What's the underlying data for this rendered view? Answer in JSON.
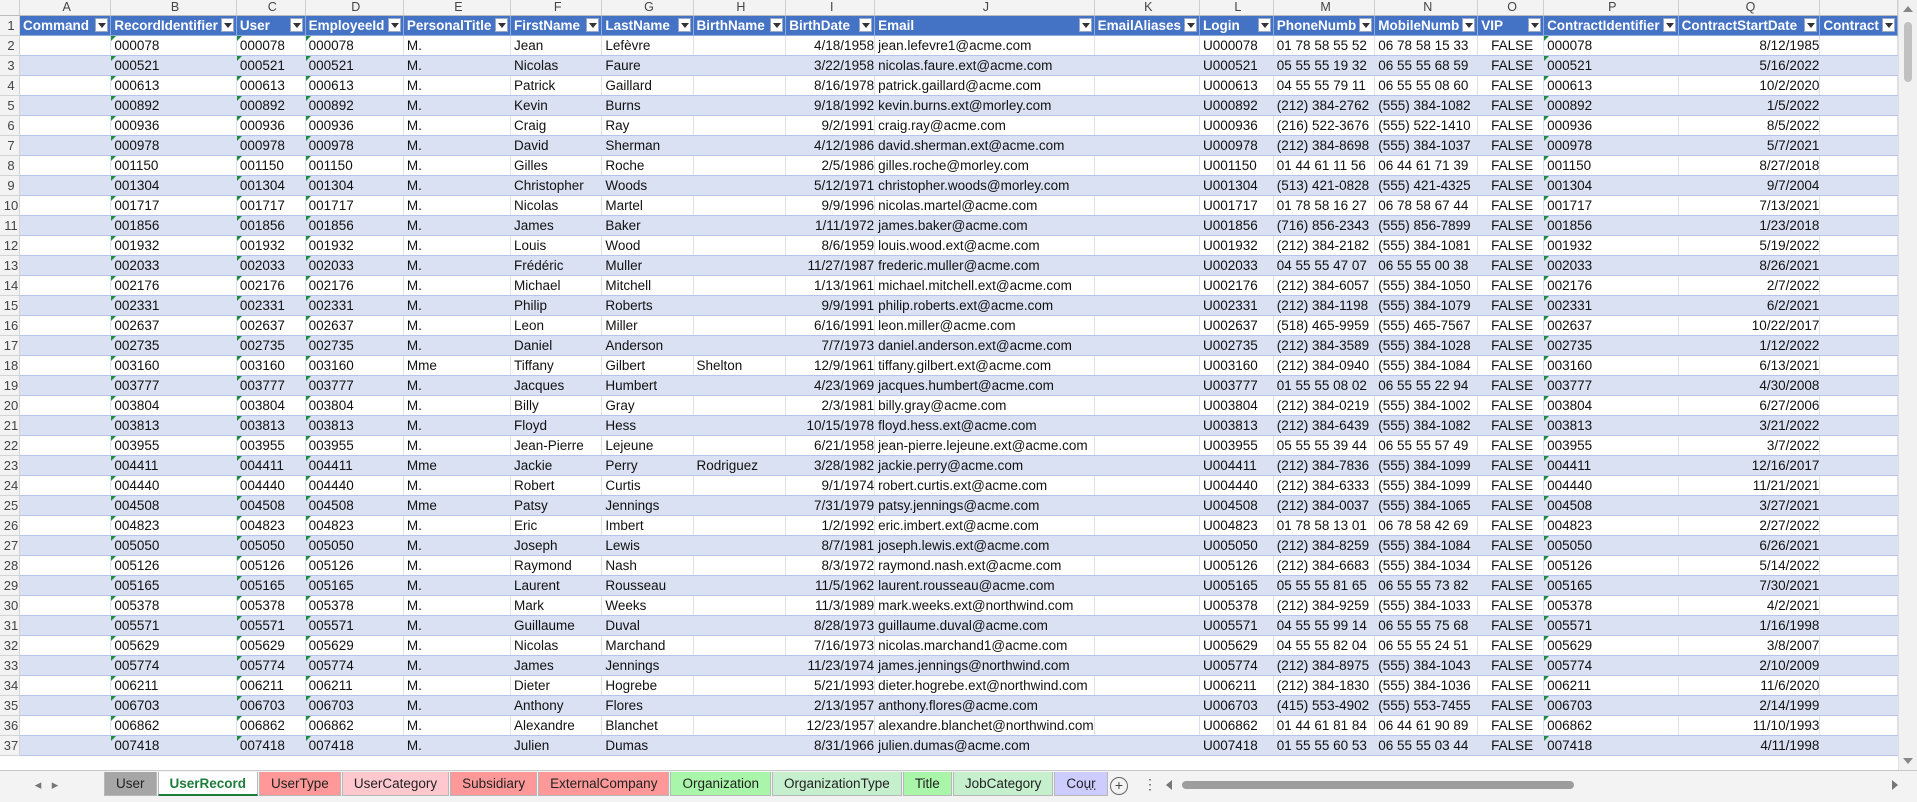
{
  "column_letters": [
    "A",
    "B",
    "C",
    "D",
    "E",
    "F",
    "G",
    "H",
    "I",
    "J",
    "K",
    "L",
    "M",
    "N",
    "O",
    "P",
    "Q"
  ],
  "header_row_number": "1",
  "headers": [
    "Command",
    "RecordIdentifier",
    "User",
    "EmployeeId",
    "PersonalTitle",
    "FirstName",
    "LastName",
    "BirthName",
    "BirthDate",
    "Email",
    "EmailAliases",
    "Login",
    "PhoneNumb",
    "MobileNumb",
    "VIP",
    "ContractIdentifier",
    "ContractStartDate",
    "Contract"
  ],
  "rows": [
    {
      "n": "2",
      "c": [
        "",
        "000078",
        "000078",
        "000078",
        "M.",
        "Jean",
        "Lefèvre",
        "",
        "4/18/1958",
        "jean.lefevre1@acme.com",
        "",
        "U000078",
        "01 78 58 55 52",
        "06 78 58 15 33",
        "FALSE",
        "000078",
        "8/12/1985"
      ]
    },
    {
      "n": "3",
      "c": [
        "",
        "000521",
        "000521",
        "000521",
        "M.",
        "Nicolas",
        "Faure",
        "",
        "3/22/1958",
        "nicolas.faure.ext@acme.com",
        "",
        "U000521",
        "05 55 55 19 32",
        "06 55 55 68 59",
        "FALSE",
        "000521",
        "5/16/2022"
      ]
    },
    {
      "n": "4",
      "c": [
        "",
        "000613",
        "000613",
        "000613",
        "M.",
        "Patrick",
        "Gaillard",
        "",
        "8/16/1978",
        "patrick.gaillard@acme.com",
        "",
        "U000613",
        "04 55 55 79 11",
        "06 55 55 08 60",
        "FALSE",
        "000613",
        "10/2/2020"
      ]
    },
    {
      "n": "5",
      "c": [
        "",
        "000892",
        "000892",
        "000892",
        "M.",
        "Kevin",
        "Burns",
        "",
        "9/18/1992",
        "kevin.burns.ext@morley.com",
        "",
        "U000892",
        "(212) 384-2762",
        "(555) 384-1082",
        "FALSE",
        "000892",
        "1/5/2022"
      ]
    },
    {
      "n": "6",
      "c": [
        "",
        "000936",
        "000936",
        "000936",
        "M.",
        "Craig",
        "Ray",
        "",
        "9/2/1991",
        "craig.ray@acme.com",
        "",
        "U000936",
        "(216) 522-3676",
        "(555) 522-1410",
        "FALSE",
        "000936",
        "8/5/2022"
      ]
    },
    {
      "n": "7",
      "c": [
        "",
        "000978",
        "000978",
        "000978",
        "M.",
        "David",
        "Sherman",
        "",
        "4/12/1986",
        "david.sherman.ext@acme.com",
        "",
        "U000978",
        "(212) 384-8698",
        "(555) 384-1037",
        "FALSE",
        "000978",
        "5/7/2021"
      ]
    },
    {
      "n": "8",
      "c": [
        "",
        "001150",
        "001150",
        "001150",
        "M.",
        "Gilles",
        "Roche",
        "",
        "2/5/1986",
        "gilles.roche@morley.com",
        "",
        "U001150",
        "01 44 61 11 56",
        "06 44 61 71 39",
        "FALSE",
        "001150",
        "8/27/2018"
      ]
    },
    {
      "n": "9",
      "c": [
        "",
        "001304",
        "001304",
        "001304",
        "M.",
        "Christopher",
        "Woods",
        "",
        "5/12/1971",
        "christopher.woods@morley.com",
        "",
        "U001304",
        "(513) 421-0828",
        "(555) 421-4325",
        "FALSE",
        "001304",
        "9/7/2004"
      ]
    },
    {
      "n": "10",
      "c": [
        "",
        "001717",
        "001717",
        "001717",
        "M.",
        "Nicolas",
        "Martel",
        "",
        "9/9/1996",
        "nicolas.martel@acme.com",
        "",
        "U001717",
        "01 78 58 16 27",
        "06 78 58 67 44",
        "FALSE",
        "001717",
        "7/13/2021"
      ]
    },
    {
      "n": "11",
      "c": [
        "",
        "001856",
        "001856",
        "001856",
        "M.",
        "James",
        "Baker",
        "",
        "1/11/1972",
        "james.baker@acme.com",
        "",
        "U001856",
        "(716) 856-2343",
        "(555) 856-7899",
        "FALSE",
        "001856",
        "1/23/2018"
      ]
    },
    {
      "n": "12",
      "c": [
        "",
        "001932",
        "001932",
        "001932",
        "M.",
        "Louis",
        "Wood",
        "",
        "8/6/1959",
        "louis.wood.ext@acme.com",
        "",
        "U001932",
        "(212) 384-2182",
        "(555) 384-1081",
        "FALSE",
        "001932",
        "5/19/2022"
      ]
    },
    {
      "n": "13",
      "c": [
        "",
        "002033",
        "002033",
        "002033",
        "M.",
        "Frédéric",
        "Muller",
        "",
        "11/27/1987",
        "frederic.muller@acme.com",
        "",
        "U002033",
        "04 55 55 47 07",
        "06 55 55 00 38",
        "FALSE",
        "002033",
        "8/26/2021"
      ]
    },
    {
      "n": "14",
      "c": [
        "",
        "002176",
        "002176",
        "002176",
        "M.",
        "Michael",
        "Mitchell",
        "",
        "1/13/1961",
        "michael.mitchell.ext@acme.com",
        "",
        "U002176",
        "(212) 384-6057",
        "(555) 384-1050",
        "FALSE",
        "002176",
        "2/7/2022"
      ]
    },
    {
      "n": "15",
      "c": [
        "",
        "002331",
        "002331",
        "002331",
        "M.",
        "Philip",
        "Roberts",
        "",
        "9/9/1991",
        "philip.roberts.ext@acme.com",
        "",
        "U002331",
        "(212) 384-1198",
        "(555) 384-1079",
        "FALSE",
        "002331",
        "6/2/2021"
      ]
    },
    {
      "n": "16",
      "c": [
        "",
        "002637",
        "002637",
        "002637",
        "M.",
        "Leon",
        "Miller",
        "",
        "6/16/1991",
        "leon.miller@acme.com",
        "",
        "U002637",
        "(518) 465-9959",
        "(555) 465-7567",
        "FALSE",
        "002637",
        "10/22/2017"
      ]
    },
    {
      "n": "17",
      "c": [
        "",
        "002735",
        "002735",
        "002735",
        "M.",
        "Daniel",
        "Anderson",
        "",
        "7/7/1973",
        "daniel.anderson.ext@acme.com",
        "",
        "U002735",
        "(212) 384-3589",
        "(555) 384-1028",
        "FALSE",
        "002735",
        "1/12/2022"
      ]
    },
    {
      "n": "18",
      "c": [
        "",
        "003160",
        "003160",
        "003160",
        "Mme",
        "Tiffany",
        "Gilbert",
        "Shelton",
        "12/9/1961",
        "tiffany.gilbert.ext@acme.com",
        "",
        "U003160",
        "(212) 384-0940",
        "(555) 384-1084",
        "FALSE",
        "003160",
        "6/13/2021"
      ]
    },
    {
      "n": "19",
      "c": [
        "",
        "003777",
        "003777",
        "003777",
        "M.",
        "Jacques",
        "Humbert",
        "",
        "4/23/1969",
        "jacques.humbert@acme.com",
        "",
        "U003777",
        "01 55 55 08 02",
        "06 55 55 22 94",
        "FALSE",
        "003777",
        "4/30/2008"
      ]
    },
    {
      "n": "20",
      "c": [
        "",
        "003804",
        "003804",
        "003804",
        "M.",
        "Billy",
        "Gray",
        "",
        "2/3/1981",
        "billy.gray@acme.com",
        "",
        "U003804",
        "(212) 384-0219",
        "(555) 384-1002",
        "FALSE",
        "003804",
        "6/27/2006"
      ]
    },
    {
      "n": "21",
      "c": [
        "",
        "003813",
        "003813",
        "003813",
        "M.",
        "Floyd",
        "Hess",
        "",
        "10/15/1978",
        "floyd.hess.ext@acme.com",
        "",
        "U003813",
        "(212) 384-6439",
        "(555) 384-1082",
        "FALSE",
        "003813",
        "3/21/2022"
      ]
    },
    {
      "n": "22",
      "c": [
        "",
        "003955",
        "003955",
        "003955",
        "M.",
        "Jean-Pierre",
        "Lejeune",
        "",
        "6/21/1958",
        "jean-pierre.lejeune.ext@acme.com",
        "",
        "U003955",
        "05 55 55 39 44",
        "06 55 55 57 49",
        "FALSE",
        "003955",
        "3/7/2022"
      ]
    },
    {
      "n": "23",
      "c": [
        "",
        "004411",
        "004411",
        "004411",
        "Mme",
        "Jackie",
        "Perry",
        "Rodriguez",
        "3/28/1982",
        "jackie.perry@acme.com",
        "",
        "U004411",
        "(212) 384-7836",
        "(555) 384-1099",
        "FALSE",
        "004411",
        "12/16/2017"
      ]
    },
    {
      "n": "24",
      "c": [
        "",
        "004440",
        "004440",
        "004440",
        "M.",
        "Robert",
        "Curtis",
        "",
        "9/1/1974",
        "robert.curtis.ext@acme.com",
        "",
        "U004440",
        "(212) 384-6333",
        "(555) 384-1099",
        "FALSE",
        "004440",
        "11/21/2021"
      ]
    },
    {
      "n": "25",
      "c": [
        "",
        "004508",
        "004508",
        "004508",
        "Mme",
        "Patsy",
        "Jennings",
        "",
        "7/31/1979",
        "patsy.jennings@acme.com",
        "",
        "U004508",
        "(212) 384-0037",
        "(555) 384-1065",
        "FALSE",
        "004508",
        "3/27/2021"
      ]
    },
    {
      "n": "26",
      "c": [
        "",
        "004823",
        "004823",
        "004823",
        "M.",
        "Eric",
        "Imbert",
        "",
        "1/2/1992",
        "eric.imbert.ext@acme.com",
        "",
        "U004823",
        "01 78 58 13 01",
        "06 78 58 42 69",
        "FALSE",
        "004823",
        "2/27/2022"
      ]
    },
    {
      "n": "27",
      "c": [
        "",
        "005050",
        "005050",
        "005050",
        "M.",
        "Joseph",
        "Lewis",
        "",
        "8/7/1981",
        "joseph.lewis.ext@acme.com",
        "",
        "U005050",
        "(212) 384-8259",
        "(555) 384-1084",
        "FALSE",
        "005050",
        "6/26/2021"
      ]
    },
    {
      "n": "28",
      "c": [
        "",
        "005126",
        "005126",
        "005126",
        "M.",
        "Raymond",
        "Nash",
        "",
        "8/3/1972",
        "raymond.nash.ext@acme.com",
        "",
        "U005126",
        "(212) 384-6683",
        "(555) 384-1034",
        "FALSE",
        "005126",
        "5/14/2022"
      ]
    },
    {
      "n": "29",
      "c": [
        "",
        "005165",
        "005165",
        "005165",
        "M.",
        "Laurent",
        "Rousseau",
        "",
        "11/5/1962",
        "laurent.rousseau@acme.com",
        "",
        "U005165",
        "05 55 55 81 65",
        "06 55 55 73 82",
        "FALSE",
        "005165",
        "7/30/2021"
      ]
    },
    {
      "n": "30",
      "c": [
        "",
        "005378",
        "005378",
        "005378",
        "M.",
        "Mark",
        "Weeks",
        "",
        "11/3/1989",
        "mark.weeks.ext@northwind.com",
        "",
        "U005378",
        "(212) 384-9259",
        "(555) 384-1033",
        "FALSE",
        "005378",
        "4/2/2021"
      ]
    },
    {
      "n": "31",
      "c": [
        "",
        "005571",
        "005571",
        "005571",
        "M.",
        "Guillaume",
        "Duval",
        "",
        "8/28/1973",
        "guillaume.duval@acme.com",
        "",
        "U005571",
        "04 55 55 99 14",
        "06 55 55 75 68",
        "FALSE",
        "005571",
        "1/16/1998"
      ]
    },
    {
      "n": "32",
      "c": [
        "",
        "005629",
        "005629",
        "005629",
        "M.",
        "Nicolas",
        "Marchand",
        "",
        "7/16/1973",
        "nicolas.marchand1@acme.com",
        "",
        "U005629",
        "04 55 55 82 04",
        "06 55 55 24 51",
        "FALSE",
        "005629",
        "3/8/2007"
      ]
    },
    {
      "n": "33",
      "c": [
        "",
        "005774",
        "005774",
        "005774",
        "M.",
        "James",
        "Jennings",
        "",
        "11/23/1974",
        "james.jennings@northwind.com",
        "",
        "U005774",
        "(212) 384-8975",
        "(555) 384-1043",
        "FALSE",
        "005774",
        "2/10/2009"
      ]
    },
    {
      "n": "34",
      "c": [
        "",
        "006211",
        "006211",
        "006211",
        "M.",
        "Dieter",
        "Hogrebe",
        "",
        "5/21/1993",
        "dieter.hogrebe.ext@northwind.com",
        "",
        "U006211",
        "(212) 384-1830",
        "(555) 384-1036",
        "FALSE",
        "006211",
        "11/6/2020"
      ]
    },
    {
      "n": "35",
      "c": [
        "",
        "006703",
        "006703",
        "006703",
        "M.",
        "Anthony",
        "Flores",
        "",
        "2/13/1957",
        "anthony.flores@acme.com",
        "",
        "U006703",
        "(415) 553-4902",
        "(555) 553-7455",
        "FALSE",
        "006703",
        "2/14/1999"
      ]
    },
    {
      "n": "36",
      "c": [
        "",
        "006862",
        "006862",
        "006862",
        "M.",
        "Alexandre",
        "Blanchet",
        "",
        "12/23/1957",
        "alexandre.blanchet@northwind.com",
        "",
        "U006862",
        "01 44 61 81 84",
        "06 44 61 90 89",
        "FALSE",
        "006862",
        "11/10/1993"
      ]
    },
    {
      "n": "37",
      "c": [
        "",
        "007418",
        "007418",
        "007418",
        "M.",
        "Julien",
        "Dumas",
        "",
        "8/31/1966",
        "julien.dumas@acme.com",
        "",
        "U007418",
        "01 55 55 60 53",
        "06 55 55 03 44",
        "FALSE",
        "007418",
        "4/11/1998"
      ]
    }
  ],
  "sheet_tabs": [
    {
      "label": "User",
      "color": "#a6a6a6",
      "active": false
    },
    {
      "label": "UserRecord",
      "color": "#ffffff",
      "active": true
    },
    {
      "label": "UserType",
      "color": "#ff9999",
      "active": false
    },
    {
      "label": "UserCategory",
      "color": "#ffc7ce",
      "active": false
    },
    {
      "label": "Subsidiary",
      "color": "#ff9999",
      "active": false
    },
    {
      "label": "ExternalCompany",
      "color": "#ff9999",
      "active": false
    },
    {
      "label": "Organization",
      "color": "#a9f5a9",
      "active": false
    },
    {
      "label": "OrganizationType",
      "color": "#c6efce",
      "active": false
    },
    {
      "label": "Title",
      "color": "#a9f5a9",
      "active": false
    },
    {
      "label": "JobCategory",
      "color": "#c6efce",
      "active": false
    },
    {
      "label": "Cour",
      "color": "#ccccff",
      "active": false
    }
  ],
  "tabbar": {
    "more": "...",
    "add": "+",
    "menu": "⋮",
    "prev": "◂",
    "next": "▸"
  },
  "colors": {
    "header_bg": "#4472c4",
    "band_a": "#d9e1f2",
    "band_b": "#ffffff",
    "active_tab": "#1e7d3a"
  }
}
